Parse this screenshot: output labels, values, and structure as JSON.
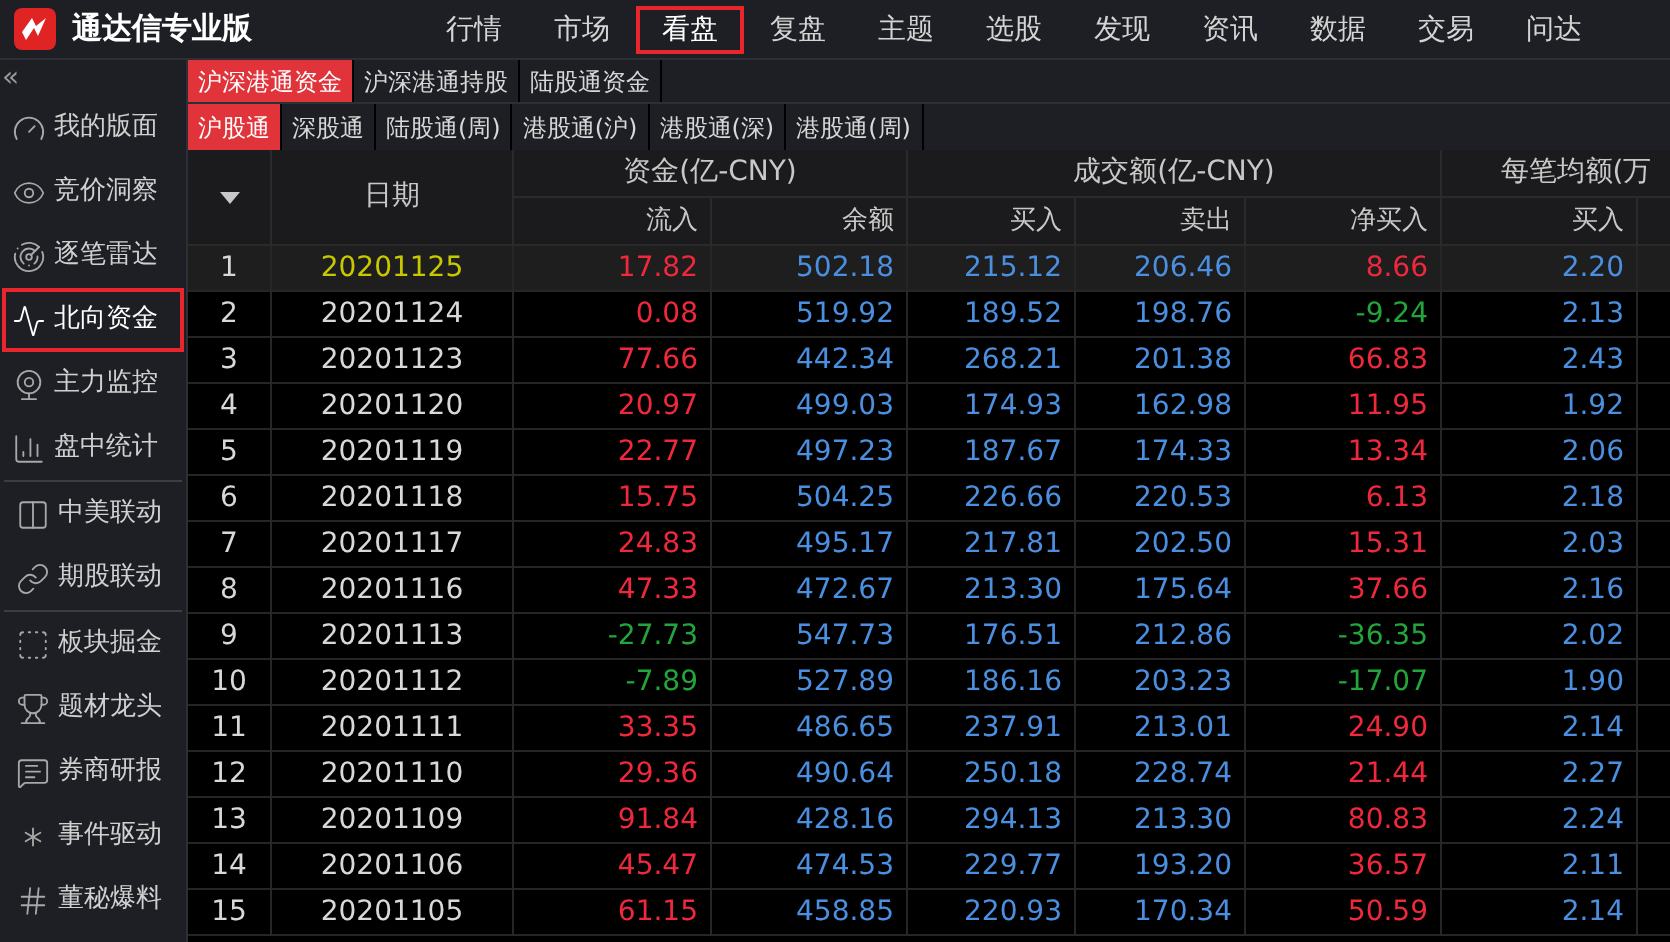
{
  "app": {
    "title": "通达信专业版"
  },
  "nav": [
    {
      "label": "行情",
      "selected": false
    },
    {
      "label": "市场",
      "selected": false
    },
    {
      "label": "看盘",
      "selected": true
    },
    {
      "label": "复盘",
      "selected": false
    },
    {
      "label": "主题",
      "selected": false
    },
    {
      "label": "选股",
      "selected": false
    },
    {
      "label": "发现",
      "selected": false
    },
    {
      "label": "资讯",
      "selected": false
    },
    {
      "label": "数据",
      "selected": false
    },
    {
      "label": "交易",
      "selected": false
    },
    {
      "label": "问达",
      "selected": false
    }
  ],
  "sidebar": {
    "collapse": "«",
    "groups": [
      [
        {
          "label": "我的版面",
          "selected": false
        },
        {
          "label": "竞价洞察",
          "selected": false
        },
        {
          "label": "逐笔雷达",
          "selected": false
        },
        {
          "label": "北向资金",
          "selected": true
        },
        {
          "label": "主力监控",
          "selected": false
        },
        {
          "label": "盘中统计",
          "selected": false
        }
      ],
      [
        {
          "label": "中美联动",
          "selected": false
        },
        {
          "label": "期股联动",
          "selected": false
        }
      ],
      [
        {
          "label": "板块掘金",
          "selected": false
        },
        {
          "label": "题材龙头",
          "selected": false
        },
        {
          "label": "券商研报",
          "selected": false
        },
        {
          "label": "事件驱动",
          "selected": false
        },
        {
          "label": "董秘爆料",
          "selected": false
        }
      ]
    ]
  },
  "tabs": [
    {
      "label": "沪深港通资金",
      "selected": true
    },
    {
      "label": "沪深港通持股",
      "selected": false
    },
    {
      "label": "陆股通资金",
      "selected": false
    }
  ],
  "subtabs": [
    {
      "label": "沪股通",
      "selected": true
    },
    {
      "label": "深股通",
      "selected": false
    },
    {
      "label": "陆股通(周)",
      "selected": false
    },
    {
      "label": "港股通(沪)",
      "selected": false
    },
    {
      "label": "港股通(深)",
      "selected": false
    },
    {
      "label": "港股通(周)",
      "selected": false
    }
  ],
  "table": {
    "date_header": "日期",
    "header_groups": [
      "资金(亿-CNY)",
      "成交额(亿-CNY)",
      "每笔均额(万"
    ],
    "columns": [
      "流入",
      "余额",
      "买入",
      "卖出",
      "净买入",
      "买入"
    ],
    "rows": [
      {
        "index": "1",
        "date": "20201125",
        "selected": true,
        "inflow": "17.82",
        "inflow_up": true,
        "balance": "502.18",
        "buy": "215.12",
        "sell": "206.46",
        "net_buy": "8.66",
        "net_up": true,
        "avg_buy": "2.20"
      },
      {
        "index": "2",
        "date": "20201124",
        "selected": false,
        "inflow": "0.08",
        "inflow_up": true,
        "balance": "519.92",
        "buy": "189.52",
        "sell": "198.76",
        "net_buy": "-9.24",
        "net_up": false,
        "avg_buy": "2.13"
      },
      {
        "index": "3",
        "date": "20201123",
        "selected": false,
        "inflow": "77.66",
        "inflow_up": true,
        "balance": "442.34",
        "buy": "268.21",
        "sell": "201.38",
        "net_buy": "66.83",
        "net_up": true,
        "avg_buy": "2.43"
      },
      {
        "index": "4",
        "date": "20201120",
        "selected": false,
        "inflow": "20.97",
        "inflow_up": true,
        "balance": "499.03",
        "buy": "174.93",
        "sell": "162.98",
        "net_buy": "11.95",
        "net_up": true,
        "avg_buy": "1.92"
      },
      {
        "index": "5",
        "date": "20201119",
        "selected": false,
        "inflow": "22.77",
        "inflow_up": true,
        "balance": "497.23",
        "buy": "187.67",
        "sell": "174.33",
        "net_buy": "13.34",
        "net_up": true,
        "avg_buy": "2.06"
      },
      {
        "index": "6",
        "date": "20201118",
        "selected": false,
        "inflow": "15.75",
        "inflow_up": true,
        "balance": "504.25",
        "buy": "226.66",
        "sell": "220.53",
        "net_buy": "6.13",
        "net_up": true,
        "avg_buy": "2.18"
      },
      {
        "index": "7",
        "date": "20201117",
        "selected": false,
        "inflow": "24.83",
        "inflow_up": true,
        "balance": "495.17",
        "buy": "217.81",
        "sell": "202.50",
        "net_buy": "15.31",
        "net_up": true,
        "avg_buy": "2.03"
      },
      {
        "index": "8",
        "date": "20201116",
        "selected": false,
        "inflow": "47.33",
        "inflow_up": true,
        "balance": "472.67",
        "buy": "213.30",
        "sell": "175.64",
        "net_buy": "37.66",
        "net_up": true,
        "avg_buy": "2.16"
      },
      {
        "index": "9",
        "date": "20201113",
        "selected": false,
        "inflow": "-27.73",
        "inflow_up": false,
        "balance": "547.73",
        "buy": "176.51",
        "sell": "212.86",
        "net_buy": "-36.35",
        "net_up": false,
        "avg_buy": "2.02"
      },
      {
        "index": "10",
        "date": "20201112",
        "selected": false,
        "inflow": "-7.89",
        "inflow_up": false,
        "balance": "527.89",
        "buy": "186.16",
        "sell": "203.23",
        "net_buy": "-17.07",
        "net_up": false,
        "avg_buy": "1.90"
      },
      {
        "index": "11",
        "date": "20201111",
        "selected": false,
        "inflow": "33.35",
        "inflow_up": true,
        "balance": "486.65",
        "buy": "237.91",
        "sell": "213.01",
        "net_buy": "24.90",
        "net_up": true,
        "avg_buy": "2.14"
      },
      {
        "index": "12",
        "date": "20201110",
        "selected": false,
        "inflow": "29.36",
        "inflow_up": true,
        "balance": "490.64",
        "buy": "250.18",
        "sell": "228.74",
        "net_buy": "21.44",
        "net_up": true,
        "avg_buy": "2.27"
      },
      {
        "index": "13",
        "date": "20201109",
        "selected": false,
        "inflow": "91.84",
        "inflow_up": true,
        "balance": "428.16",
        "buy": "294.13",
        "sell": "213.30",
        "net_buy": "80.83",
        "net_up": true,
        "avg_buy": "2.24"
      },
      {
        "index": "14",
        "date": "20201106",
        "selected": false,
        "inflow": "45.47",
        "inflow_up": true,
        "balance": "474.53",
        "buy": "229.77",
        "sell": "193.20",
        "net_buy": "36.57",
        "net_up": true,
        "avg_buy": "2.11"
      },
      {
        "index": "15",
        "date": "20201105",
        "selected": false,
        "inflow": "61.15",
        "inflow_up": true,
        "balance": "458.85",
        "buy": "220.93",
        "sell": "170.34",
        "net_buy": "50.59",
        "net_up": true,
        "avg_buy": "2.14"
      }
    ]
  }
}
